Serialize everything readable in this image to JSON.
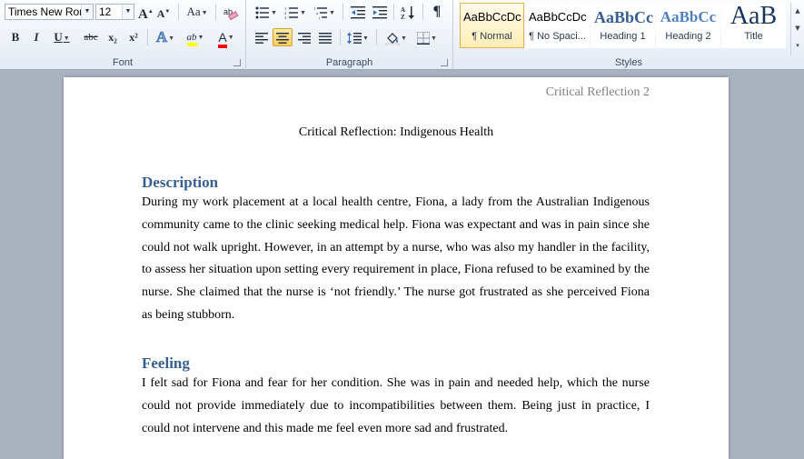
{
  "ribbon": {
    "font": {
      "label": "Font",
      "font_name": "Times New Rom",
      "font_size": "12",
      "grow": "A",
      "shrink": "A",
      "change_case": "Aa",
      "bold": "B",
      "italic": "I",
      "underline": "U",
      "strikethrough": "abc",
      "subscript": "x₂",
      "superscript": "x²",
      "text_effects": "A",
      "highlight": "ab",
      "font_color": "A",
      "highlight_color": "#ffff00",
      "font_color_value": "#ff0000"
    },
    "paragraph": {
      "label": "Paragraph",
      "pilcrow": "¶"
    },
    "styles": {
      "label": "Styles",
      "items": [
        {
          "preview": "AaBbCcDc",
          "name": "¶ Normal",
          "selected": true
        },
        {
          "preview": "AaBbCcDc",
          "name": "¶ No Spaci..."
        },
        {
          "preview": "AaBbCc",
          "name": "Heading 1"
        },
        {
          "preview": "AaBbCc",
          "name": "Heading 2"
        },
        {
          "preview": "AaB",
          "name": "Title"
        }
      ]
    }
  },
  "document": {
    "header": "Critical Reflection 2",
    "title": "Critical Reflection: Indigenous Health",
    "sections": [
      {
        "heading": "Description",
        "body": "During my work placement at a local health centre, Fiona, a lady from the Australian Indigenous community came to the clinic seeking medical help. Fiona was expectant and was in pain since she could not walk upright. However, in an attempt by a nurse, who was also my handler in the facility, to assess her situation upon setting every requirement in place, Fiona refused to be examined by the nurse. She claimed that the nurse is ‘not friendly.’ The nurse got frustrated as she perceived Fiona as being stubborn."
      },
      {
        "heading": "Feeling",
        "body": "I felt sad for Fiona and fear for her condition. She was in pain and needed help, which the nurse could not provide immediately due to incompatibilities between them. Being just in practice, I could not intervene and this made me feel even more sad and frustrated."
      }
    ]
  }
}
